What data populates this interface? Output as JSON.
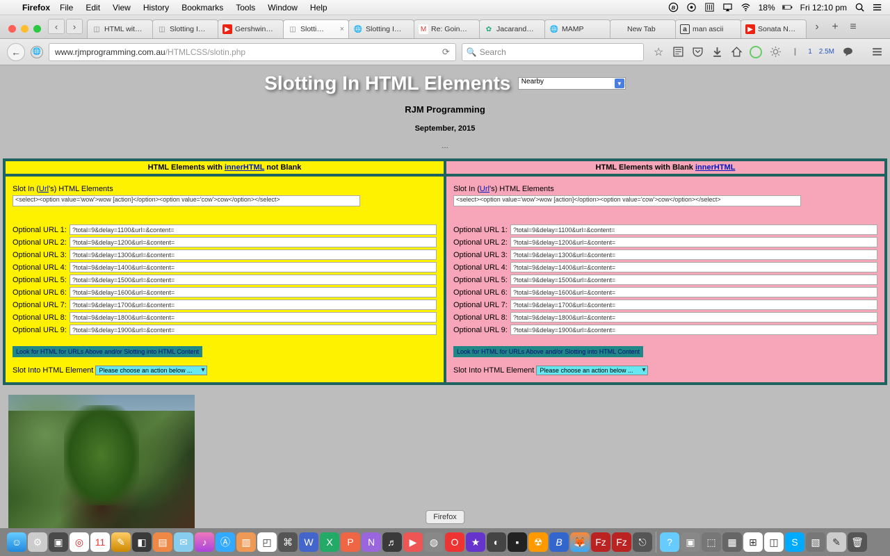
{
  "menubar": {
    "app": "Firefox",
    "items": [
      "File",
      "Edit",
      "View",
      "History",
      "Bookmarks",
      "Tools",
      "Window",
      "Help"
    ],
    "battery": "18%",
    "clock": "Fri 12:10 pm"
  },
  "tabs": [
    {
      "label": "HTML wit…",
      "active": false,
      "icon": "page"
    },
    {
      "label": "Slotting I…",
      "active": false,
      "icon": "page"
    },
    {
      "label": "Gershwin…",
      "active": false,
      "icon": "yt"
    },
    {
      "label": "Slotti…",
      "active": true,
      "icon": "page",
      "closable": true
    },
    {
      "label": "Slotting I…",
      "active": false,
      "icon": "globe"
    },
    {
      "label": "Re: Goin…",
      "active": false,
      "icon": "mail"
    },
    {
      "label": "Jacarand…",
      "active": false,
      "icon": "leaf"
    },
    {
      "label": "MAMP",
      "active": false,
      "icon": "globe"
    },
    {
      "label": "New Tab",
      "active": false,
      "icon": ""
    },
    {
      "label": "man ascii",
      "active": false,
      "icon": "a"
    },
    {
      "label": "Sonata N…",
      "active": false,
      "icon": "yt"
    }
  ],
  "url": {
    "host": "www.rjmprogramming.com.au",
    "path": "/HTMLCSS/slotin.php",
    "search_placeholder": "Search",
    "counter_one": "1",
    "counter_two": "2.5M"
  },
  "page": {
    "title": "Slotting In HTML Elements",
    "nearby": "Nearby",
    "subtitle": "RJM Programming",
    "date": "September, 2015",
    "dots": "…"
  },
  "panel_left": {
    "heading_pre": "HTML Elements with ",
    "heading_link": "innerHTML",
    "heading_post": " not Blank",
    "slot_pre": "Slot In (",
    "slot_link": "Url",
    "slot_post": "'s) HTML Elements",
    "wide_value": "<select><option value='wow'>wow [action]</option><option value='cow'>cow</option></select>",
    "urls": [
      {
        "label": "Optional URL 1:",
        "val": "?total=9&delay=1100&url=&content="
      },
      {
        "label": "Optional URL 2:",
        "val": "?total=9&delay=1200&url=&content="
      },
      {
        "label": "Optional URL 3:",
        "val": "?total=9&delay=1300&url=&content="
      },
      {
        "label": "Optional URL 4:",
        "val": "?total=9&delay=1400&url=&content="
      },
      {
        "label": "Optional URL 5:",
        "val": "?total=9&delay=1500&url=&content="
      },
      {
        "label": "Optional URL 6:",
        "val": "?total=9&delay=1600&url=&content="
      },
      {
        "label": "Optional URL 7:",
        "val": "?total=9&delay=1700&url=&content="
      },
      {
        "label": "Optional URL 8:",
        "val": "?total=9&delay=1800&url=&content="
      },
      {
        "label": "Optional URL 9:",
        "val": "?total=9&delay=1900&url=&content="
      }
    ],
    "look_btn": "Look for HTML for URLs Above and/or Slotting into HTML Content",
    "slotinto_label": "Slot Into HTML Element",
    "slotinto_sel": "Please choose an action below ..."
  },
  "panel_right": {
    "heading_pre": "HTML Elements with Blank ",
    "heading_link": "innerHTML",
    "heading_post": "",
    "slot_pre": "Slot In (",
    "slot_link": "Url",
    "slot_post": "'s) HTML Elements",
    "wide_value": "<select><option value='wow'>wow [action]</option><option value='cow'>cow</option></select>",
    "urls": [
      {
        "label": "Optional URL 1:",
        "val": "?total=9&delay=1100&url=&content="
      },
      {
        "label": "Optional URL 2:",
        "val": "?total=9&delay=1200&url=&content="
      },
      {
        "label": "Optional URL 3:",
        "val": "?total=9&delay=1300&url=&content="
      },
      {
        "label": "Optional URL 4:",
        "val": "?total=9&delay=1400&url=&content="
      },
      {
        "label": "Optional URL 5:",
        "val": "?total=9&delay=1500&url=&content="
      },
      {
        "label": "Optional URL 6:",
        "val": "?total=9&delay=1600&url=&content="
      },
      {
        "label": "Optional URL 7:",
        "val": "?total=9&delay=1700&url=&content="
      },
      {
        "label": "Optional URL 8:",
        "val": "?total=9&delay=1800&url=&content="
      },
      {
        "label": "Optional URL 9:",
        "val": "?total=9&delay=1900&url=&content="
      }
    ],
    "look_btn": "Look for HTML for URLs Above and/or Slotting into HTML Content",
    "slotinto_label": "Slot Into HTML Element",
    "slotinto_sel": "Please choose an action below ..."
  },
  "dock_tooltip": "Firefox"
}
